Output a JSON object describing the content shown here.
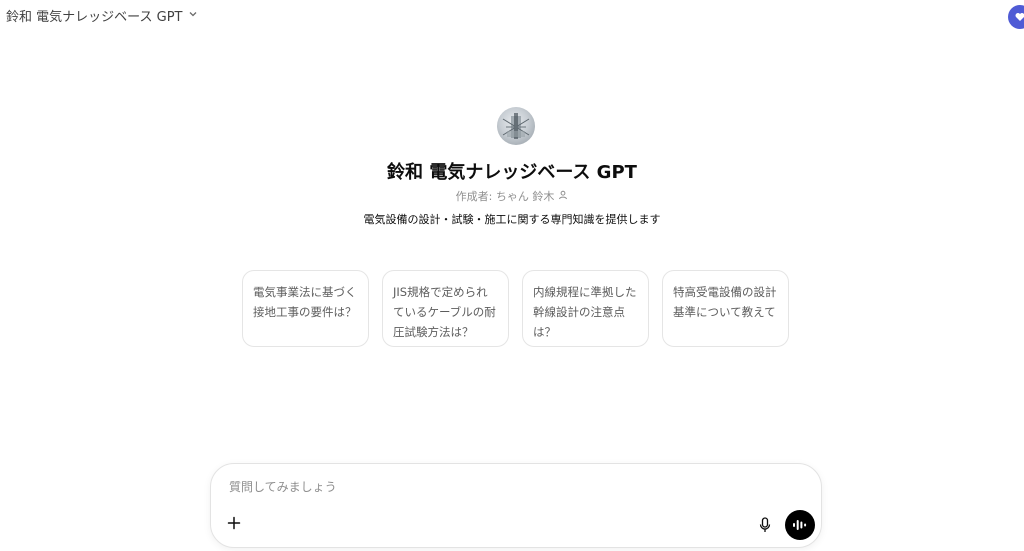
{
  "header": {
    "model_name": "鈴和 電気ナレッジベース GPT",
    "chevron_icon": "chevron-down-icon",
    "corner_badge_color": "#4f5bd5"
  },
  "profile": {
    "avatar_icon": "gpt-avatar-image",
    "title": "鈴和 電気ナレッジベース GPT",
    "author_label": "作成者: ちゃん 鈴木",
    "author_icon": "person-icon",
    "description": "電気設備の設計・試験・施工に関する専門知識を提供します"
  },
  "suggestions": [
    "電気事業法に基づく接地工事の要件は？",
    "JIS規格で定められているケーブルの耐圧試験方法は？",
    "内線規程に準拠した幹線設計の注意点は？",
    "特高受電設備の設計基準について教えて"
  ],
  "composer": {
    "placeholder": "質問してみましょう",
    "value": "",
    "plus_icon": "plus-icon",
    "mic_icon": "microphone-icon",
    "voice_icon": "voice-mode-icon"
  }
}
